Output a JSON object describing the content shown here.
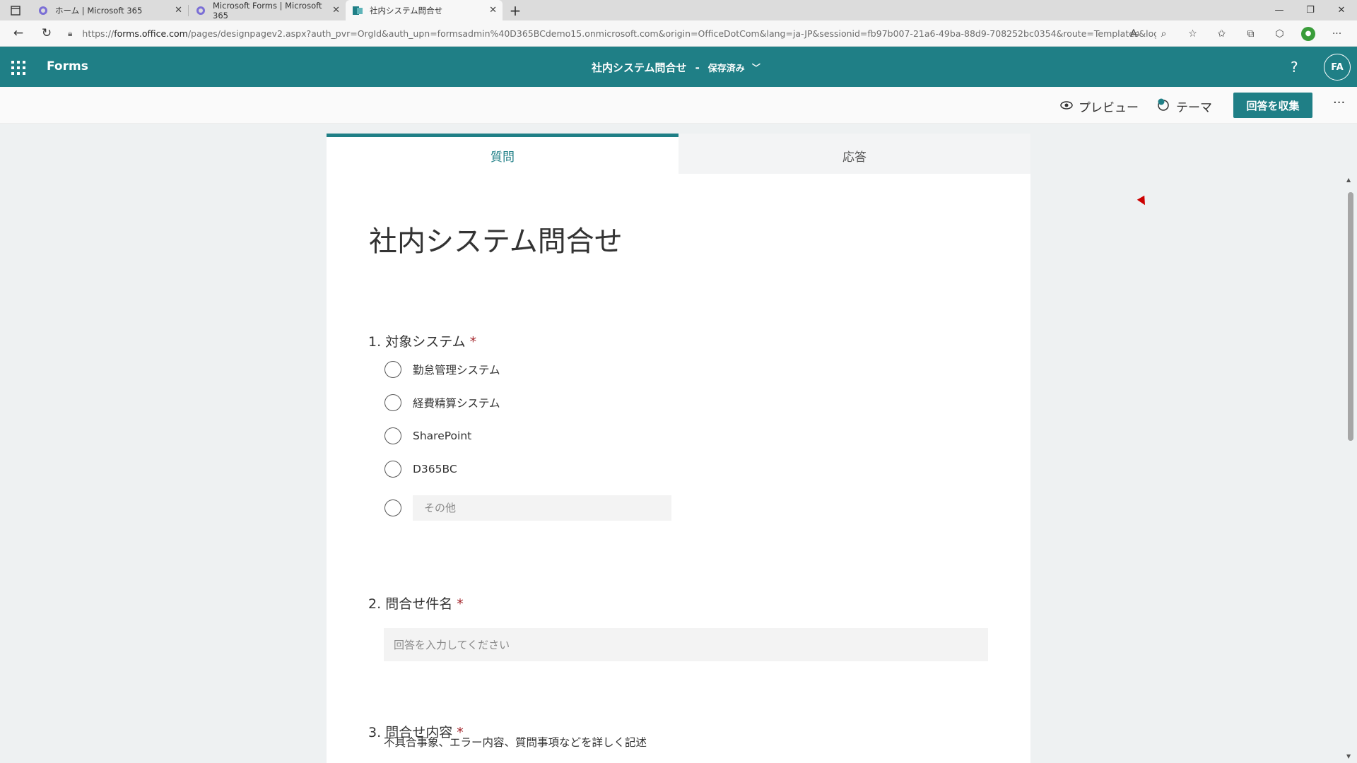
{
  "browser": {
    "tabs": [
      {
        "title": "ホーム | Microsoft 365",
        "active": false
      },
      {
        "title": "Microsoft Forms | Microsoft 365",
        "active": false
      },
      {
        "title": "社内システム問合せ",
        "active": true
      }
    ],
    "new_tab": "+",
    "url_host": "forms.office.com",
    "url_prefix": "https://",
    "url_rest": "/pages/designpagev2.aspx?auth_pvr=OrgId&auth_upn=formsadmin%40D365BCdemo15.onmicrosoft.com&origin=OfficeDotCom&lang=ja-JP&sessionid=fb97b007-21a6-49ba-88d9-708252bc0354&route=Templates&login_h..."
  },
  "app": {
    "name": "Forms",
    "doc_title": "社内システム問合せ",
    "separator": "-",
    "save_state": "保存済み",
    "avatar_initials": "FA",
    "help": "?"
  },
  "commands": {
    "preview": "プレビュー",
    "theme": "テーマ",
    "collect": "回答を収集",
    "more": "···"
  },
  "form_tabs": {
    "questions": "質問",
    "responses": "応答"
  },
  "form": {
    "title": "社内システム問合せ",
    "questions": [
      {
        "number": "1.",
        "title": "対象システム",
        "required": "*",
        "options": [
          "勤怠管理システム",
          "経費精算システム",
          "SharePoint",
          "D365BC"
        ],
        "other_placeholder": "その他"
      },
      {
        "number": "2.",
        "title": "問合せ件名",
        "required": "*",
        "answer_placeholder": "回答を入力してください"
      },
      {
        "number": "3.",
        "title": "問合せ内容",
        "required": "*",
        "description": "不具合事象、エラー内容、質問事項などを詳しく記述"
      }
    ]
  },
  "colors": {
    "brand": "#1f7f86",
    "required": "#a4262c"
  }
}
